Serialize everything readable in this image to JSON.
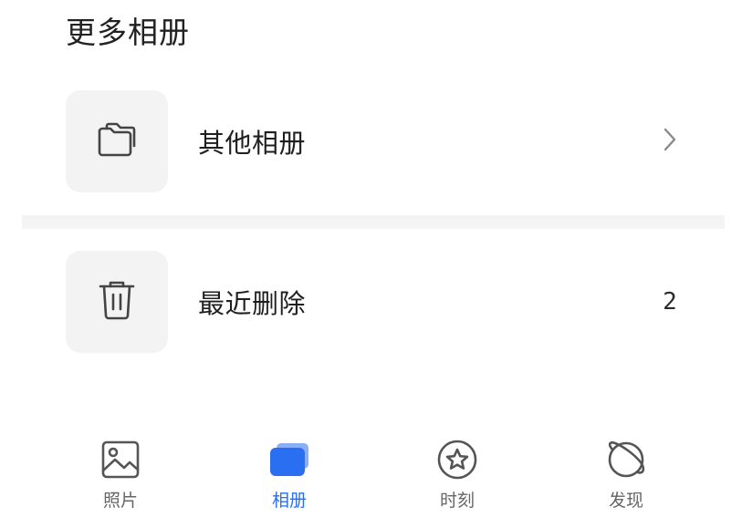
{
  "section": {
    "title": "更多相册"
  },
  "rows": {
    "other_albums": {
      "label": "其他相册",
      "icon": "folder-icon",
      "trailing_icon": "chevron-right-icon"
    },
    "recently_deleted": {
      "label": "最近删除",
      "icon": "trash-icon",
      "count": "2"
    }
  },
  "tabs": {
    "photos": {
      "label": "照片",
      "icon": "image-icon",
      "active": false
    },
    "albums": {
      "label": "相册",
      "icon": "albums-icon",
      "active": true
    },
    "moments": {
      "label": "时刻",
      "icon": "star-circle-icon",
      "active": false
    },
    "discover": {
      "label": "发现",
      "icon": "planet-icon",
      "active": false
    }
  },
  "colors": {
    "accent": "#2a6ef2",
    "icon_box_bg": "#f3f3f3",
    "inactive_tab": "#666666",
    "text": "#1f1f1f"
  }
}
